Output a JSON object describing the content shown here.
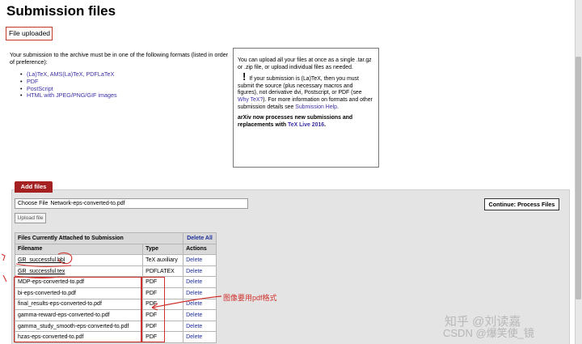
{
  "page": {
    "title": "Submission files"
  },
  "flash": {
    "message": "File uploaded"
  },
  "intro": {
    "text": "Your submission to the archive must be in one of the following formats (listed in order of preference):"
  },
  "formats": [
    "(La)TeX, AMS(La)TeX, PDFLaTeX",
    "PDF",
    "PostScript",
    "HTML with JPEG/PNG/GIF images"
  ],
  "info": {
    "p1": "You can upload all your files at once as a single .tar.gz or .zip file, or upload individual files as needed.",
    "bang": "!",
    "p2_a": "If your submission is (La)TeX, then you must submit the source (plus necessary macros and figures), not derivative dvi, Postscript, or PDF (see ",
    "why_tex": "Why TeX?",
    "p2_b": "). For more information on formats and other submission details see ",
    "help": "Submission Help",
    "p2_c": ".",
    "p3_a": "arXiv now processes new submissions and replacements with ",
    "texlive": "TeX Live 2016",
    "p3_b": "."
  },
  "panel": {
    "tab": "Add files",
    "choose_label": "Choose File",
    "chosen_file": "Network-eps-converted-to.pdf",
    "upload_label": "Upload file",
    "continue_label": "Continue: Process Files"
  },
  "files_table": {
    "caption": "Files Currently Attached to Submission",
    "delete_all": "Delete All",
    "headers": [
      "Filename",
      "Type",
      "Actions"
    ],
    "rows": [
      {
        "name": "GR_successful.bbl",
        "type": "TeX auxiliary",
        "action": "Delete"
      },
      {
        "name": "GR_successful.tex",
        "type": "PDFLATEX",
        "action": "Delete"
      },
      {
        "name": "MDP-eps-converted-to.pdf",
        "type": "PDF",
        "action": "Delete"
      },
      {
        "name": "bi-eps-converted-to.pdf",
        "type": "PDF",
        "action": "Delete"
      },
      {
        "name": "final_results-eps-converted-to.pdf",
        "type": "PDF",
        "action": "Delete"
      },
      {
        "name": "gamma-reward-eps-converted-to.pdf",
        "type": "PDF",
        "action": "Delete"
      },
      {
        "name": "gamma_study_smooth-eps-converted-to.pdf",
        "type": "PDF",
        "action": "Delete"
      },
      {
        "name": "hzas-eps-converted-to.pdf",
        "type": "PDF",
        "action": "Delete"
      }
    ]
  },
  "annotation": {
    "text": "图像要用pdf格式",
    "color": "#d0312d"
  },
  "watermark": {
    "line1": "知乎 @刘读嘉",
    "line2": "CSDN @爆笑使_镜"
  }
}
